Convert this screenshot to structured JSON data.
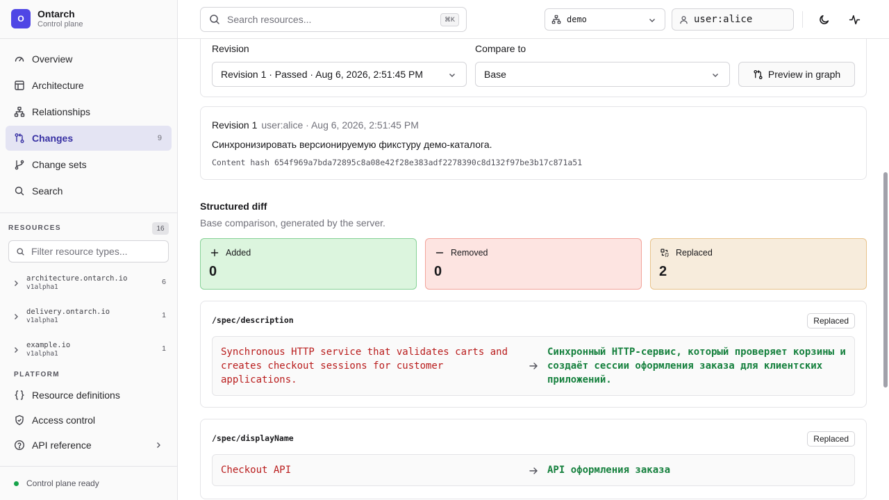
{
  "brand": {
    "logo_letter": "O",
    "name": "Ontarch",
    "subtitle": "Control plane"
  },
  "nav": [
    {
      "label": "Overview",
      "icon": "gauge-icon"
    },
    {
      "label": "Architecture",
      "icon": "layout-icon"
    },
    {
      "label": "Relationships",
      "icon": "network-icon"
    },
    {
      "label": "Changes",
      "icon": "git-compare-icon",
      "badge": "9",
      "active": true
    },
    {
      "label": "Change sets",
      "icon": "git-branch-icon"
    },
    {
      "label": "Search",
      "icon": "search-icon"
    }
  ],
  "resources": {
    "heading": "RESOURCES",
    "count": "16",
    "filter_placeholder": "Filter resource types...",
    "groups": [
      {
        "name": "architecture.ontarch.io",
        "version": "v1alpha1",
        "count": "6"
      },
      {
        "name": "delivery.ontarch.io",
        "version": "v1alpha1",
        "count": "1"
      },
      {
        "name": "example.io",
        "version": "v1alpha1",
        "count": "1"
      }
    ]
  },
  "platform": {
    "heading": "PLATFORM",
    "items": [
      {
        "label": "Resource definitions",
        "icon": "braces-icon"
      },
      {
        "label": "Access control",
        "icon": "shield-icon"
      },
      {
        "label": "API reference",
        "icon": "help-circle-icon"
      }
    ]
  },
  "status": {
    "text": "Control plane ready",
    "color": "#16a34a"
  },
  "topbar": {
    "search_placeholder": "Search resources...",
    "shortcut": "⌘K",
    "context": "demo",
    "user": "user:alice"
  },
  "revision_picker": {
    "revision_label": "Revision",
    "revision_value": "Revision 1 · Passed · Aug 6, 2026, 2:51:45 PM",
    "compare_label": "Compare to",
    "compare_value": "Base",
    "preview_button": "Preview in graph"
  },
  "revision": {
    "title": "Revision 1",
    "meta": "user:alice · Aug 6, 2026, 2:51:45 PM",
    "message": "Синхронизировать версионируемую фикстуру демо-каталога.",
    "hash_label": "Content hash",
    "hash": "654f969a7bda72895c8a08e42f28e383adf2278390c8d132f97be3b17c871a51"
  },
  "structured_diff": {
    "title": "Structured diff",
    "subtitle": "Base comparison, generated by the server.",
    "stats": [
      {
        "label": "Added",
        "value": "0",
        "icon": "plus-icon",
        "bg": "#dcf5de",
        "border": "#86d196"
      },
      {
        "label": "Removed",
        "value": "0",
        "icon": "minus-icon",
        "bg": "#fde4e1",
        "border": "#f2a39a"
      },
      {
        "label": "Replaced",
        "value": "2",
        "icon": "replace-icon",
        "bg": "#f7ecdc",
        "border": "#e8c28a"
      }
    ],
    "changes": [
      {
        "path": "/spec/description",
        "kind": "Replaced",
        "old": "Synchronous HTTP service that validates carts and creates checkout sessions for customer applications.",
        "new": "Синхронный HTTP-сервис, который проверяет корзины и создаёт сессии оформления заказа для клиентских приложений."
      },
      {
        "path": "/spec/displayName",
        "kind": "Replaced",
        "old": "Checkout API",
        "new": "API оформления заказа"
      }
    ]
  }
}
